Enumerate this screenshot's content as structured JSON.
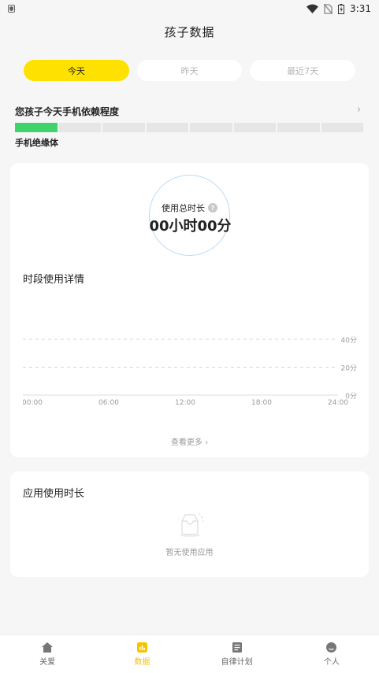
{
  "status_bar": {
    "time": "3:31"
  },
  "header": {
    "title": "孩子数据"
  },
  "tabs": [
    {
      "label": "今天",
      "active": true
    },
    {
      "label": "昨天",
      "active": false
    },
    {
      "label": "最近7天",
      "active": false
    }
  ],
  "dependency": {
    "title": "您孩子今天手机依赖程度",
    "level_label": "手机绝缘体",
    "segments_total": 8,
    "segments_filled": 1,
    "fill_color": "#3ed36b"
  },
  "usage": {
    "label": "使用总时长",
    "help": "?",
    "value": "00小时00分"
  },
  "period": {
    "title": "时段使用详情",
    "see_more": "查看更多 ›"
  },
  "chart_data": {
    "type": "bar",
    "x_ticks": [
      "00:00",
      "06:00",
      "12:00",
      "18:00",
      "24:00"
    ],
    "y_ticks": [
      "40分",
      "20分",
      "0分"
    ],
    "ylim": [
      0,
      40
    ],
    "values": []
  },
  "apps": {
    "title": "应用使用时长",
    "empty_text": "暂无使用应用"
  },
  "bottom_nav": [
    {
      "label": "关爱",
      "icon": "home-icon",
      "active": false
    },
    {
      "label": "数据",
      "icon": "data-icon",
      "active": true
    },
    {
      "label": "自律计划",
      "icon": "plan-icon",
      "active": false
    },
    {
      "label": "个人",
      "icon": "profile-icon",
      "active": false
    }
  ],
  "colors": {
    "accent": "#ffe100",
    "nav_active": "#f5c400",
    "circle": "#b7dcf5"
  }
}
